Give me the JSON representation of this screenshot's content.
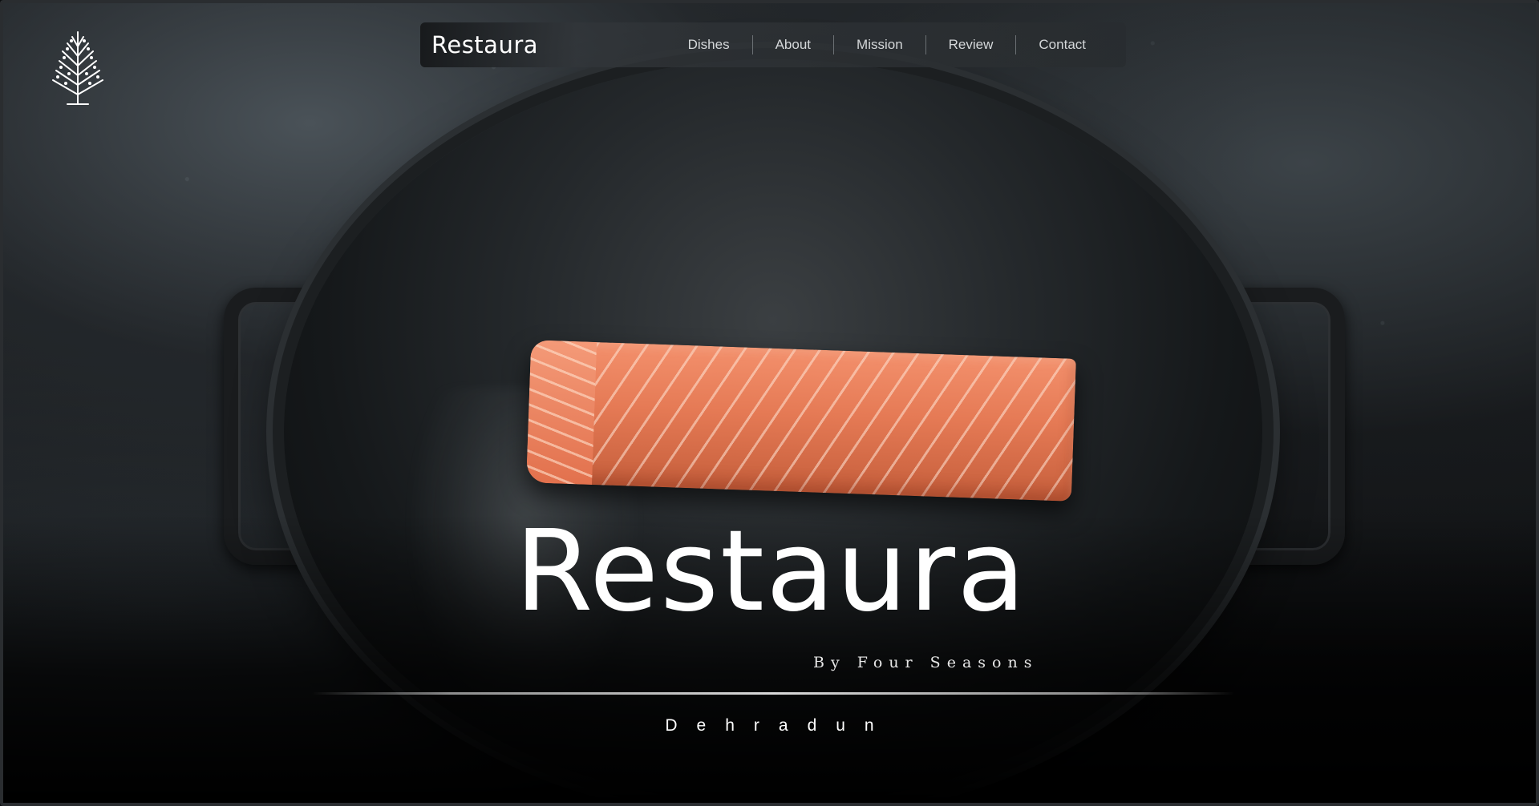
{
  "logo": {
    "icon": "tree-logo-icon"
  },
  "nav": {
    "brand": "Restaura",
    "links": [
      {
        "label": "Dishes"
      },
      {
        "label": "About"
      },
      {
        "label": "Mission"
      },
      {
        "label": "Review"
      },
      {
        "label": "Contact"
      }
    ]
  },
  "hero": {
    "title": "Restaura",
    "subtitle": "By Four Seasons",
    "location": "Dehradun"
  },
  "colors": {
    "background": "#121416",
    "text": "#ffffff",
    "salmon": "#e57a55"
  }
}
